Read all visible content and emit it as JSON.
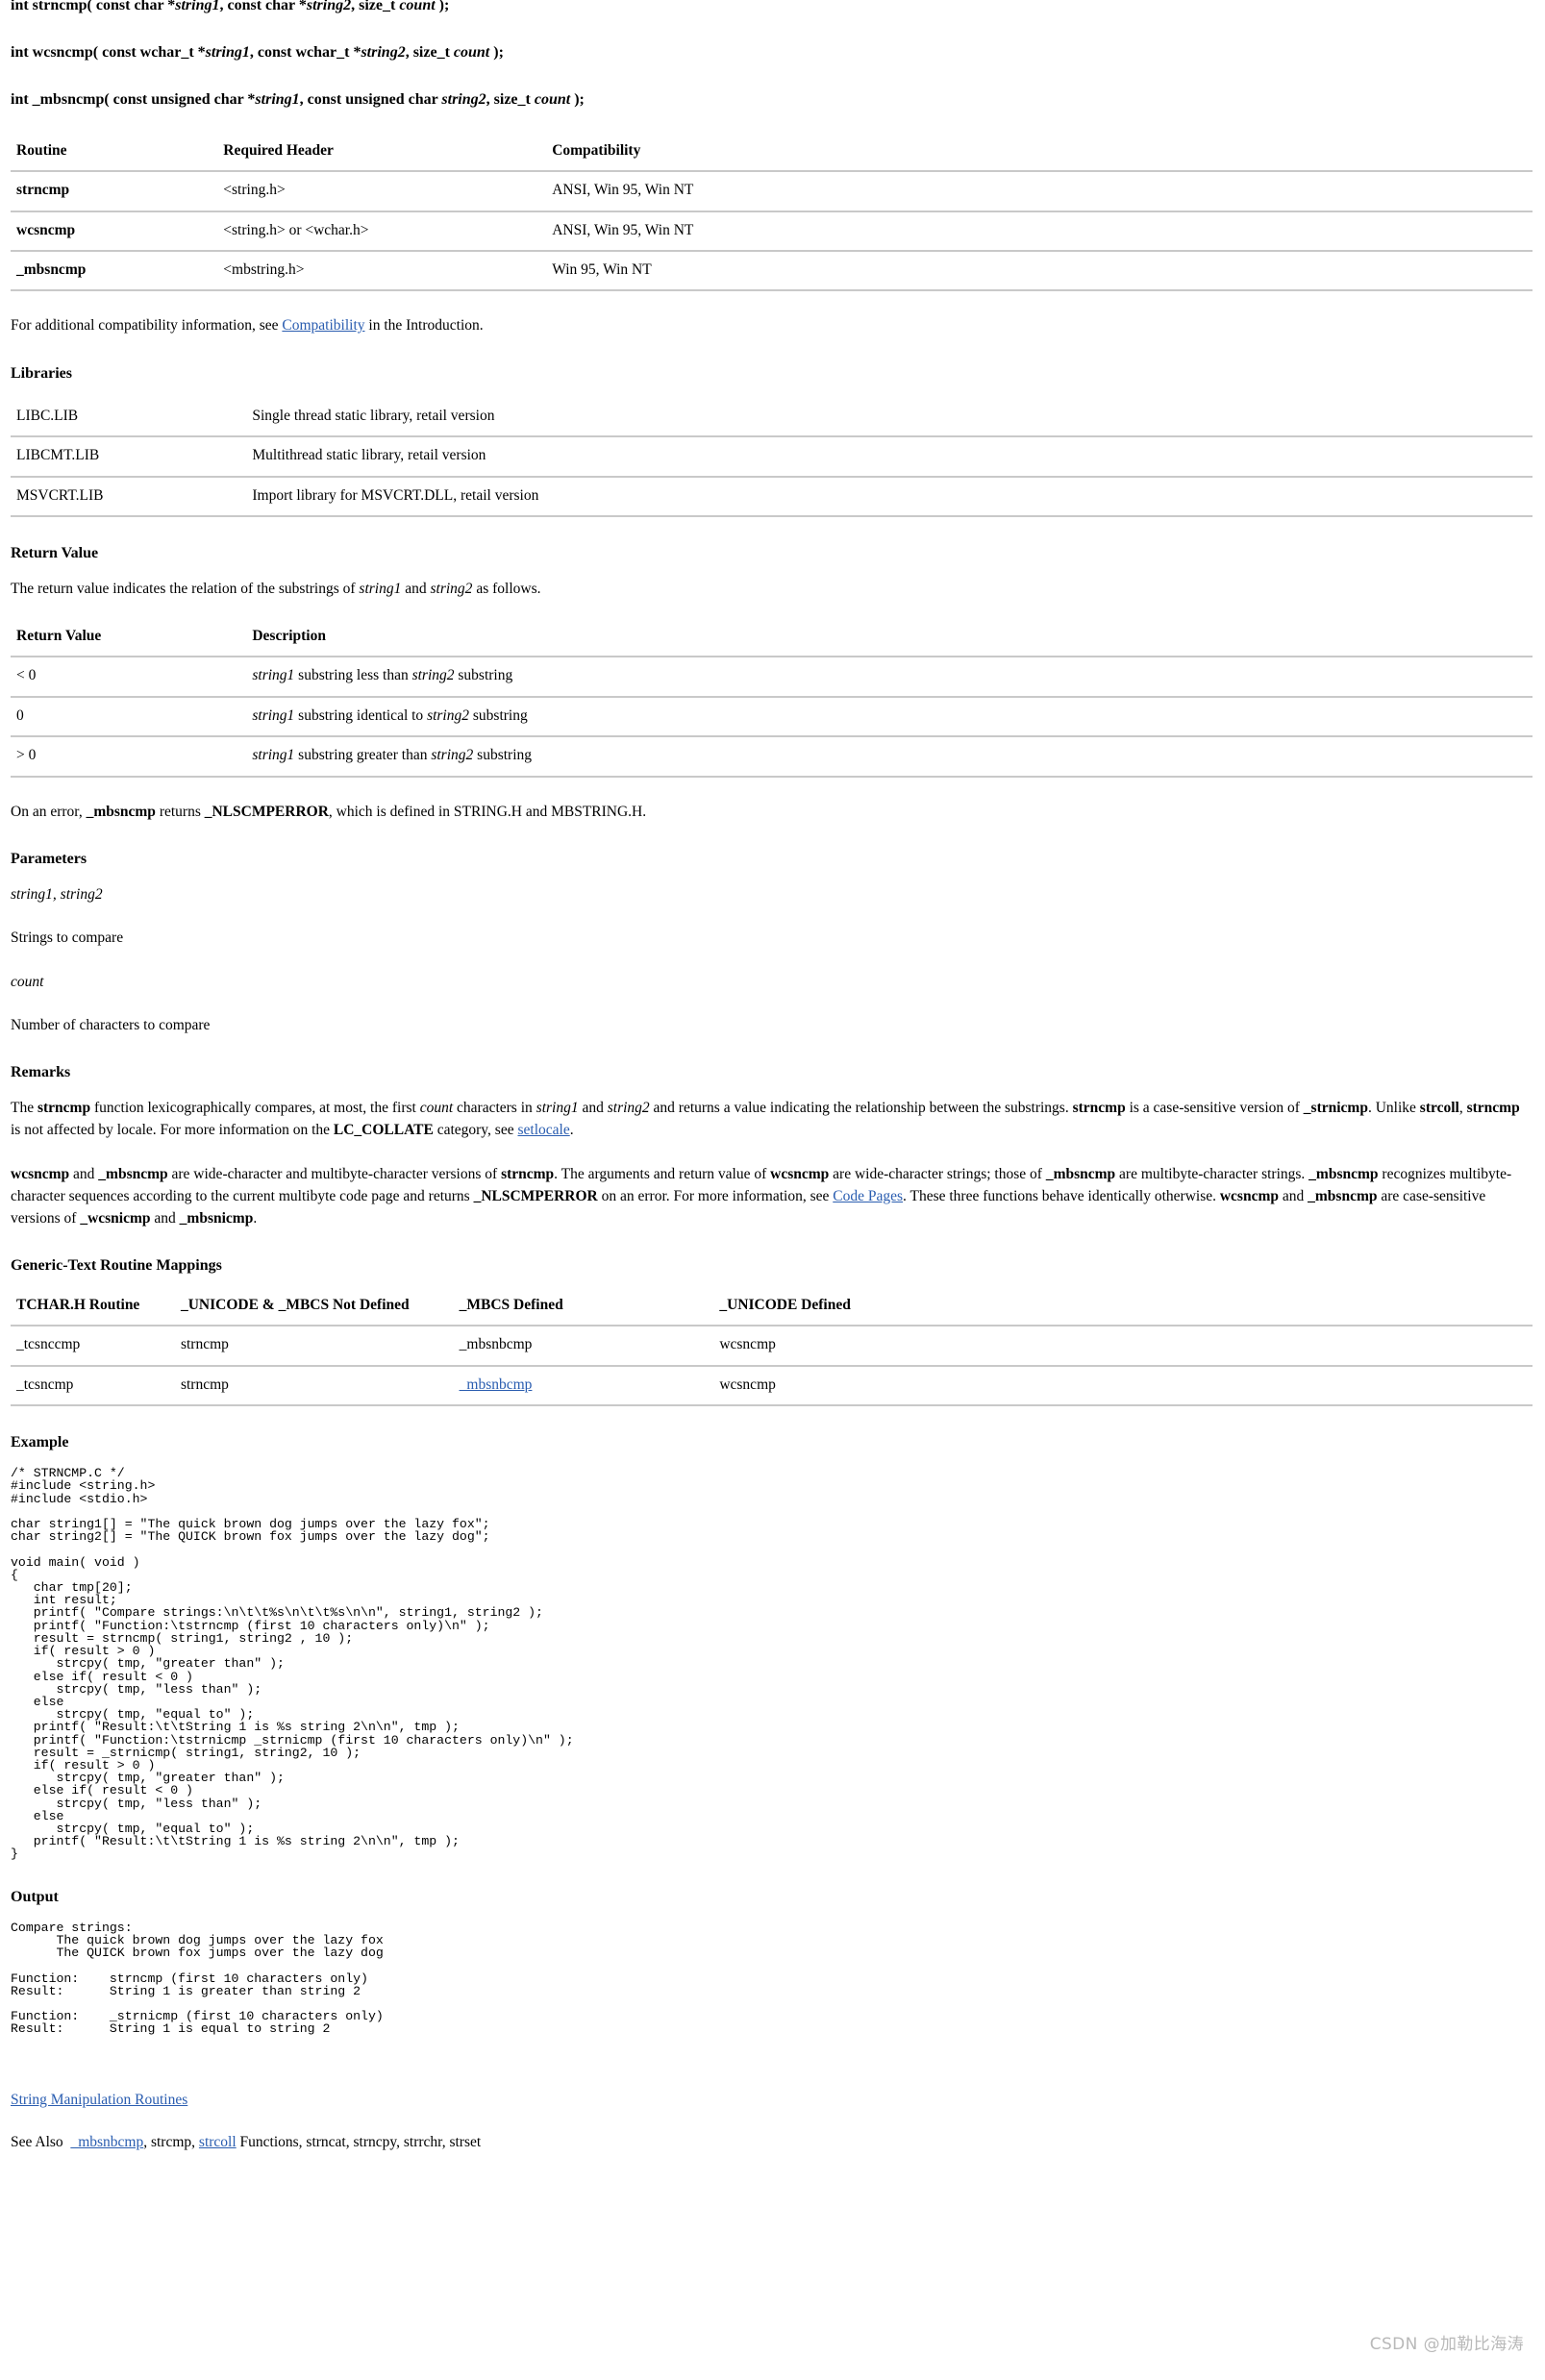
{
  "prototypes": [
    "int strncmp( const char *string1, const char *string2, size_t count );",
    "int wcsncmp( const wchar_t *string1, const wchar_t *string2, size_t count );",
    "int _mbsncmp( const unsigned char *string1, const unsigned char string2, size_t count );"
  ],
  "routine_table": {
    "headers": [
      "Routine",
      "Required Header",
      "Compatibility"
    ],
    "rows": [
      [
        "strncmp",
        "<string.h>",
        "ANSI, Win 95, Win NT"
      ],
      [
        "wcsncmp",
        "<string.h> or <wchar.h>",
        "ANSI, Win 95, Win NT"
      ],
      [
        "_mbsncmp",
        "<mbstring.h>",
        "Win 95, Win NT"
      ]
    ]
  },
  "compat_note": {
    "before": "For additional compatibility information, see ",
    "link": "Compatibility",
    "after": " in the Introduction."
  },
  "libraries": {
    "heading": "Libraries",
    "rows": [
      [
        "LIBC.LIB",
        "Single thread static library, retail version"
      ],
      [
        "LIBCMT.LIB",
        "Multithread static library, retail version"
      ],
      [
        "MSVCRT.LIB",
        "Import library for MSVCRT.DLL, retail version"
      ]
    ]
  },
  "return_value": {
    "heading": "Return Value",
    "intro_a": "The return value indicates the relation of the substrings of ",
    "intro_string1": "string1",
    "intro_b": " and ",
    "intro_string2": "string2",
    "intro_c": " as follows.",
    "headers": [
      "Return Value",
      "Description"
    ],
    "rows": [
      {
        "value": "< 0",
        "s1": "string1",
        "mid": " substring less than ",
        "s2": "string2",
        "tail": " substring"
      },
      {
        "value": "0",
        "s1": "string1",
        "mid": " substring identical to ",
        "s2": "string2",
        "tail": " substring"
      },
      {
        "value": "> 0",
        "s1": "string1",
        "mid": " substring greater than ",
        "s2": "string2",
        "tail": " substring"
      }
    ],
    "error_note_a": "On an error, ",
    "error_note_fn": "_mbsncmp",
    "error_note_b": " returns ",
    "error_note_const": "_NLSCMPERROR",
    "error_note_c": ", which is defined in STRING.H and MBSTRING.H."
  },
  "parameters": {
    "heading": "Parameters",
    "param1_name": "string1, string2",
    "param1_desc": "Strings to compare",
    "param2_name": "count",
    "param2_desc": "Number of characters to compare"
  },
  "remarks": {
    "heading": "Remarks",
    "p1": {
      "a": "The ",
      "b1": "strncmp",
      "c": " function lexicographically compares, at most, the first ",
      "i1": "count",
      "d": " characters in ",
      "i2": "string1",
      "e": " and ",
      "i3": "string2",
      "f": " and returns a value indicating the relationship between the substrings. ",
      "b2": "strncmp",
      "g": " is a case-sensitive version of ",
      "b3": "_strnicmp",
      "h": ". Unlike ",
      "b4": "strcoll",
      "i": ", ",
      "b5": "strncmp",
      "j": " is not affected by locale. For more information on the ",
      "b6": "LC_COLLATE",
      "k": " category, see ",
      "link": "setlocale",
      "l": "."
    },
    "p2": {
      "b1": "wcsncmp",
      "a": " and ",
      "b2": "_mbsncmp",
      "c": " are wide-character and multibyte-character versions of ",
      "b3": "strncmp",
      "d": ". The arguments and return value of ",
      "b4": "wcsncmp",
      "e": " are wide-character strings; those of ",
      "b5": "_mbsncmp",
      "f": " are multibyte-character strings. ",
      "b6": "_mbsncmp",
      "g": " recognizes multibyte-character sequences according to the current multibyte code page and returns ",
      "b7": "_NLSCMPERROR",
      "h": " on an error. For more information, see ",
      "link": "Code Pages",
      "i": ". These three functions behave identically otherwise. ",
      "b8": "wcsncmp",
      "j": " and ",
      "b9": "_mbsncmp",
      "k": " are case-sensitive versions of ",
      "b10": "_wcsnicmp",
      "l": " and ",
      "b11": "_mbsnicmp",
      "m": "."
    }
  },
  "mappings": {
    "heading": "Generic-Text Routine Mappings",
    "headers": [
      "TCHAR.H Routine",
      "_UNICODE & _MBCS Not Defined",
      "_MBCS Defined",
      "_UNICODE Defined"
    ],
    "rows": [
      {
        "cells": [
          "_tcsnccmp",
          "strncmp",
          "_mbsnbcmp",
          "wcsncmp"
        ],
        "link_col": -1
      },
      {
        "cells": [
          "_tcsncmp",
          "strncmp",
          "_mbsnbcmp",
          "wcsncmp"
        ],
        "link_col": 2
      }
    ]
  },
  "example": {
    "heading": "Example",
    "code": "/* STRNCMP.C */\n#include <string.h>\n#include <stdio.h>\n\nchar string1[] = \"The quick brown dog jumps over the lazy fox\";\nchar string2[] = \"The QUICK brown fox jumps over the lazy dog\";\n\nvoid main( void )\n{\n   char tmp[20];\n   int result;\n   printf( \"Compare strings:\\n\\t\\t%s\\n\\t\\t%s\\n\\n\", string1, string2 );\n   printf( \"Function:\\tstrncmp (first 10 characters only)\\n\" );\n   result = strncmp( string1, string2 , 10 );\n   if( result > 0 )\n      strcpy( tmp, \"greater than\" );\n   else if( result < 0 )\n      strcpy( tmp, \"less than\" );\n   else\n      strcpy( tmp, \"equal to\" );\n   printf( \"Result:\\t\\tString 1 is %s string 2\\n\\n\", tmp );\n   printf( \"Function:\\tstrnicmp _strnicmp (first 10 characters only)\\n\" );\n   result = _strnicmp( string1, string2, 10 );\n   if( result > 0 )\n      strcpy( tmp, \"greater than\" );\n   else if( result < 0 )\n      strcpy( tmp, \"less than\" );\n   else\n      strcpy( tmp, \"equal to\" );\n   printf( \"Result:\\t\\tString 1 is %s string 2\\n\\n\", tmp );\n}"
  },
  "output": {
    "heading": "Output",
    "text": "Compare strings:\n      The quick brown dog jumps over the lazy fox\n      The QUICK brown fox jumps over the lazy dog\n\nFunction:    strncmp (first 10 characters only)\nResult:      String 1 is greater than string 2\n\nFunction:    _strnicmp (first 10 characters only)\nResult:      String 1 is equal to string 2"
  },
  "footer": {
    "link1": "String Manipulation Routines",
    "see_also_prefix": "See Also",
    "link2": "_mbsnbcmp",
    "mid": ", strcmp, ",
    "link3": "strcoll",
    "tail": " Functions, strncat, strncpy, strrchr, strset"
  },
  "watermark": "CSDN @加勒比海涛",
  "colors": {
    "link": "#2a5db0",
    "rule": "#c9c9c9",
    "text": "#000000",
    "watermark": "#b9b9b9"
  }
}
